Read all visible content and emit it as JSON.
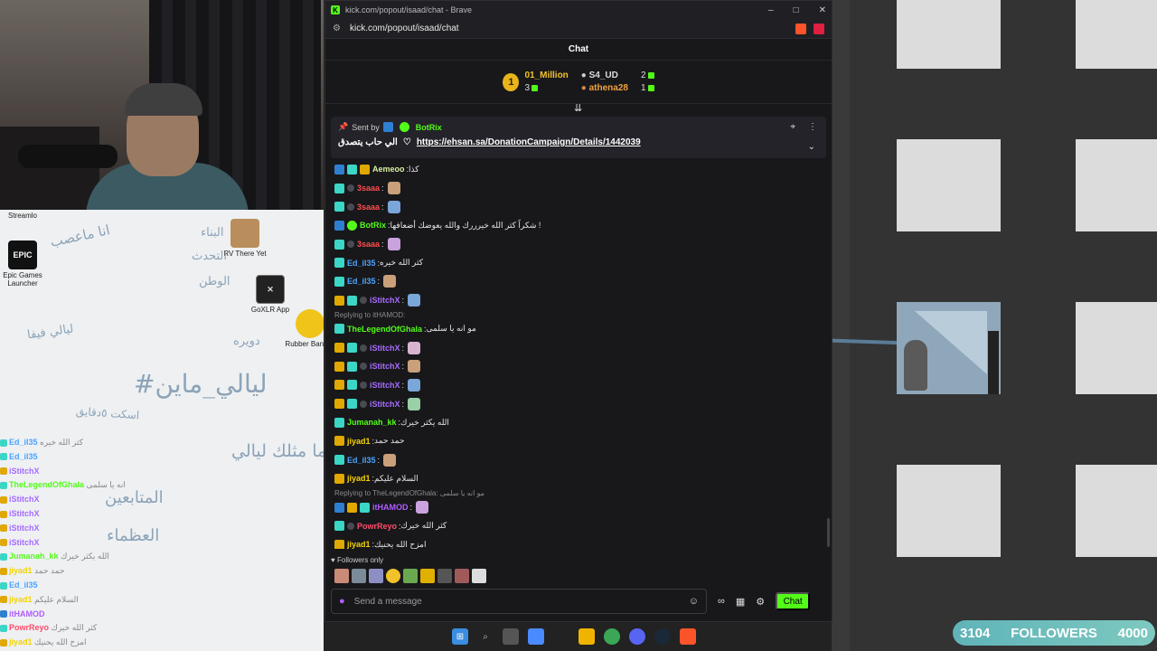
{
  "browser": {
    "title": "kick.com/popout/isaad/chat - Brave",
    "url": "kick.com/popout/isaad/chat"
  },
  "chat": {
    "header": "Chat",
    "leaderboard": {
      "first": {
        "rank": "1",
        "name": "01_Million",
        "gifts": "3"
      },
      "second": {
        "name": "S4_UD",
        "gifts": "2"
      },
      "third": {
        "name": "athena28",
        "gifts": "1"
      }
    },
    "pinned": {
      "sent_by_label": "Sent by",
      "sender": "BotRix",
      "text": "الي حاب يتصدق",
      "link": "https://ehsan.sa/DonationCampaign/Details/1442039"
    },
    "messages": [
      {
        "type": "msg",
        "badges": [
          "bot",
          "og",
          "vip"
        ],
        "user": "Aemeoo",
        "color": "#d7f0a0",
        "text": "كذا"
      },
      {
        "type": "msg",
        "badges": [
          "og",
          "gift"
        ],
        "user": "3saaa",
        "color": "#ff4d4d",
        "text": "",
        "emote": true
      },
      {
        "type": "msg",
        "badges": [
          "og",
          "gift"
        ],
        "user": "3saaa",
        "color": "#ff4d4d",
        "text": "",
        "emote": true
      },
      {
        "type": "msg",
        "badges": [
          "bot",
          "verified"
        ],
        "user": "BotRix",
        "color": "#53fc18",
        "text": "شكراً كثر الله خيرررك والله يعوضك أضعافها !"
      },
      {
        "type": "msg",
        "badges": [
          "og",
          "gift"
        ],
        "user": "3saaa",
        "color": "#ff4d4d",
        "text": "",
        "emote": true
      },
      {
        "type": "msg",
        "badges": [
          "og"
        ],
        "user": "Ed_il35",
        "color": "#4da3ff",
        "text": "كثر الله خيره"
      },
      {
        "type": "msg",
        "badges": [
          "og"
        ],
        "user": "Ed_il35",
        "color": "#4da3ff",
        "text": "",
        "emote": true
      },
      {
        "type": "msg",
        "badges": [
          "vip",
          "og",
          "gift"
        ],
        "user": "iStitchX",
        "color": "#a66bff",
        "text": "",
        "emote": true
      },
      {
        "type": "reply",
        "text": "Replying to itHAMOD:"
      },
      {
        "type": "msg",
        "badges": [
          "og"
        ],
        "user": "TheLegendOfGhala",
        "color": "#53fc18",
        "text": "مو انه يا سلمى"
      },
      {
        "type": "msg",
        "badges": [
          "vip",
          "og",
          "gift"
        ],
        "user": "iStitchX",
        "color": "#a66bff",
        "text": "",
        "emote": true
      },
      {
        "type": "msg",
        "badges": [
          "vip",
          "og",
          "gift"
        ],
        "user": "iStitchX",
        "color": "#a66bff",
        "text": "",
        "emote": true
      },
      {
        "type": "msg",
        "badges": [
          "vip",
          "og",
          "gift"
        ],
        "user": "iStitchX",
        "color": "#a66bff",
        "text": "",
        "emote": true
      },
      {
        "type": "msg",
        "badges": [
          "vip",
          "og",
          "gift"
        ],
        "user": "iStitchX",
        "color": "#a66bff",
        "text": "",
        "emote": true
      },
      {
        "type": "msg",
        "badges": [
          "og"
        ],
        "user": "Jumanah_kk",
        "color": "#53fc18",
        "text": "الله يكثر خيرك"
      },
      {
        "type": "msg",
        "badges": [
          "vip"
        ],
        "user": "jiyad1",
        "color": "#f5d300",
        "text": "حمد حمد"
      },
      {
        "type": "msg",
        "badges": [
          "og"
        ],
        "user": "Ed_il35",
        "color": "#4da3ff",
        "text": "",
        "emote": true
      },
      {
        "type": "msg",
        "badges": [
          "vip"
        ],
        "user": "jiyad1",
        "color": "#f5d300",
        "text": "السلام عليكم"
      },
      {
        "type": "reply",
        "text": "Replying to TheLegendOfGhala: مو انه يا سلمى"
      },
      {
        "type": "msg",
        "badges": [
          "bot",
          "vip",
          "og"
        ],
        "user": "itHAMOD",
        "color": "#b05cff",
        "text": "",
        "emote": true
      },
      {
        "type": "msg",
        "badges": [
          "og",
          "gift"
        ],
        "user": "PowrReyo",
        "color": "#ff4d6a",
        "text": "كثر الله خيرك"
      },
      {
        "type": "msg",
        "badges": [
          "vip"
        ],
        "user": "jiyad1",
        "color": "#f5d300",
        "text": "امزح الله يحنيك"
      }
    ],
    "followers_only": "Followers only",
    "input_placeholder": "Send a message",
    "chat_button": "Chat"
  },
  "desktop": {
    "icons": [
      {
        "label": "Streamlo"
      },
      {
        "label": "Epic Games Launcher"
      },
      {
        "label": "RV There Yet"
      },
      {
        "label": "GoXLR App"
      },
      {
        "label": "Rubber Bandits"
      }
    ],
    "arabic_texts": [
      "انا ماعصب",
      "البناء",
      "التحدث",
      "الوطن",
      "ليالي فيفا",
      "دويره",
      "#ليالي_ماين",
      "اسكت ٥دقايق",
      "ما مثلك ليالي",
      "المتابعين",
      "العظماء"
    ]
  },
  "overlay_chat": [
    {
      "user": "Ed_il35",
      "text": "كثر الله خيره"
    },
    {
      "user": "Ed_il35",
      "text": ""
    },
    {
      "user": "iStitchX",
      "text": ""
    },
    {
      "user": "TheLegendOfGhala",
      "text": "مو انه يا سلمى"
    },
    {
      "user": "iStitchX",
      "text": ""
    },
    {
      "user": "iStitchX",
      "text": ""
    },
    {
      "user": "iStitchX",
      "text": ""
    },
    {
      "user": "iStitchX",
      "text": ""
    },
    {
      "user": "Jumanah_kk",
      "text": "الله يكثر خيرك"
    },
    {
      "user": "jiyad1",
      "text": "حمد حمد"
    },
    {
      "user": "Ed_il35",
      "text": ""
    },
    {
      "user": "jiyad1",
      "text": "السلام عليكم"
    },
    {
      "user": "itHAMOD",
      "text": ""
    },
    {
      "user": "PowrReyo",
      "text": "كثر الله خيرك"
    },
    {
      "user": "jiyad1",
      "text": "امزح الله يحنيك"
    }
  ],
  "followers_bar": {
    "current": "3104",
    "label": "FOLLOWERS",
    "goal": "4000"
  },
  "colors": {
    "kick_green": "#53fc18",
    "bg": "#18181b"
  }
}
